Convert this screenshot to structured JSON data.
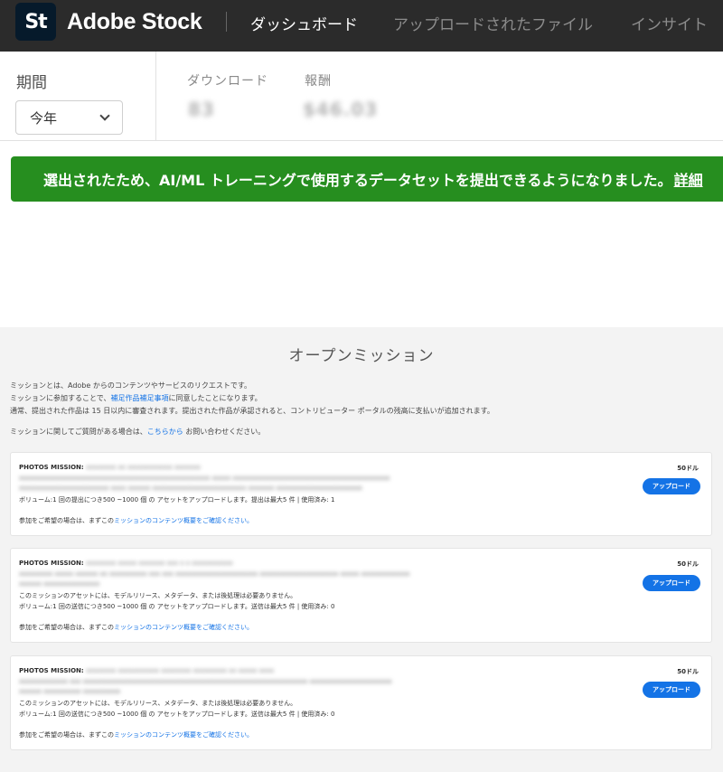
{
  "header": {
    "logo_text": "St",
    "brand": "Adobe Stock",
    "nav": [
      "ダッシュボード",
      "アップロードされたファイル",
      "インサイト"
    ]
  },
  "filters": {
    "period_label": "期間",
    "period_value": "今年",
    "download_label": "ダウンロード",
    "download_value": "83",
    "revenue_label": "報酬",
    "revenue_value": "$46.03"
  },
  "banner": {
    "text": "選出されたため、AI/ML トレーニングで使用するデータセットを提出できるようになりました。",
    "link": "詳細",
    "color": "#268e1f"
  },
  "missions": {
    "title": "オープンミッション",
    "intro_1": "ミッションとは、Adobe からのコンテンツやサービスのリクエストです。",
    "intro_2_pre": "ミッションに参加することで、",
    "intro_2_link": "補足作品補足事項",
    "intro_2_post": "に同意したことになります。",
    "intro_3": "通常、提出された作品は 15 日以内に審査されます。提出された作品が承認されると、コントリビューター ポータルの残高に支払いが追加されます。",
    "intro_4_pre": "ミッションに関してご質問がある場合は、",
    "intro_4_link": "こちらから",
    "intro_4_post": "お問い合わせください。",
    "cards": [
      {
        "label": "PHOTOS MISSION:",
        "title_blur": "xxxxxxxx xx xxxxxxxxxxxx  xxxxxxx",
        "desc_blur_1": "xxxxxxxxxxxxxxxxxxxxxxxxxxxxxxxxxxxxxxxxxxxxxxxxxxx xxxxx xxxxxxxxxxxxxxxxxxxxxxxxxxxxxxxxxxxxxxxxxx",
        "desc_blur_2": "xxxxxxxxxxxxxxxxxxxxxxxx xxxx xxxxxx xxxxxxxxxxxxxxxxxxxxxxxxx xxxxxxx xxxxxxxxxxxxxxxxxxxxxxx",
        "line_1": "ボリューム:1 回の提出につき500 ~1000 個 の アセットをアップロードします。提出は最大5 件 | 使用済み: 1",
        "footer_pre": "参加をご希望の場合は、まずこの",
        "footer_link": "ミッションのコンテンツ概要をご確認ください。",
        "price": "50ドル",
        "button": "アップロード"
      },
      {
        "label": "PHOTOS MISSION:",
        "title_blur": "xxxxxxxx xxxxx xxxxxxx xxx x x xxxxxxxxxxx",
        "desc_blur_1": "xxxxxxxxx xxxxx xxxxxx xx xxxxxxxxxx xxx xxx xxxxxxxxxxxxxxxxxxxxxx xxxxxxxxxxxxxxxxxxxxx xxxxx xxxxxxxxxxxxx",
        "desc_blur_2": "xxxxxx xxxxxxxxxxxxxxx",
        "line_1": "このミッションのアセットには、モデルリリース、メタデータ、または後処理は必要ありません。",
        "line_2": "ボリューム:1 回の送信につき500 ~1000 個 の アセットをアップロードします。送信は最大5 件 | 使用済み: 0",
        "footer_pre": "参加をご希望の場合は、まずこの",
        "footer_link": "ミッションのコンテンツ概要をご確認ください。",
        "price": "50ドル",
        "button": "アップロード"
      },
      {
        "label": "PHOTOS MISSION:",
        "title_blur": "xxxxxxxx xxxxxxxxxxx xxxxxxxx xxxxxxxxx xx xxxxx xxxx",
        "desc_blur_1": "xxxxxxxxxxxxx xxx xxxxxxxxxxxxxxxxxxxxxxxxxxxxxxxxxxxxxxxxxxxxxxxxxxxxxxxxxxxx xxxxxxxxxxxxxxxxxxxxxx",
        "desc_blur_2": "xxxxxx xxxxxxxxxx xxxxxxxxxx",
        "line_1": "このミッションのアセットには、モデルリリース、メタデータ、または後処理は必要ありません。",
        "line_2": "ボリューム:1 回の送信につき500 ~1000 個 の アセットをアップロードします。送信は最大5 件 | 使用済み: 0",
        "footer_pre": "参加をご希望の場合は、まずこの",
        "footer_link": "ミッションのコンテンツ概要をご確認ください。",
        "price": "50ドル",
        "button": "アップロード"
      }
    ]
  }
}
